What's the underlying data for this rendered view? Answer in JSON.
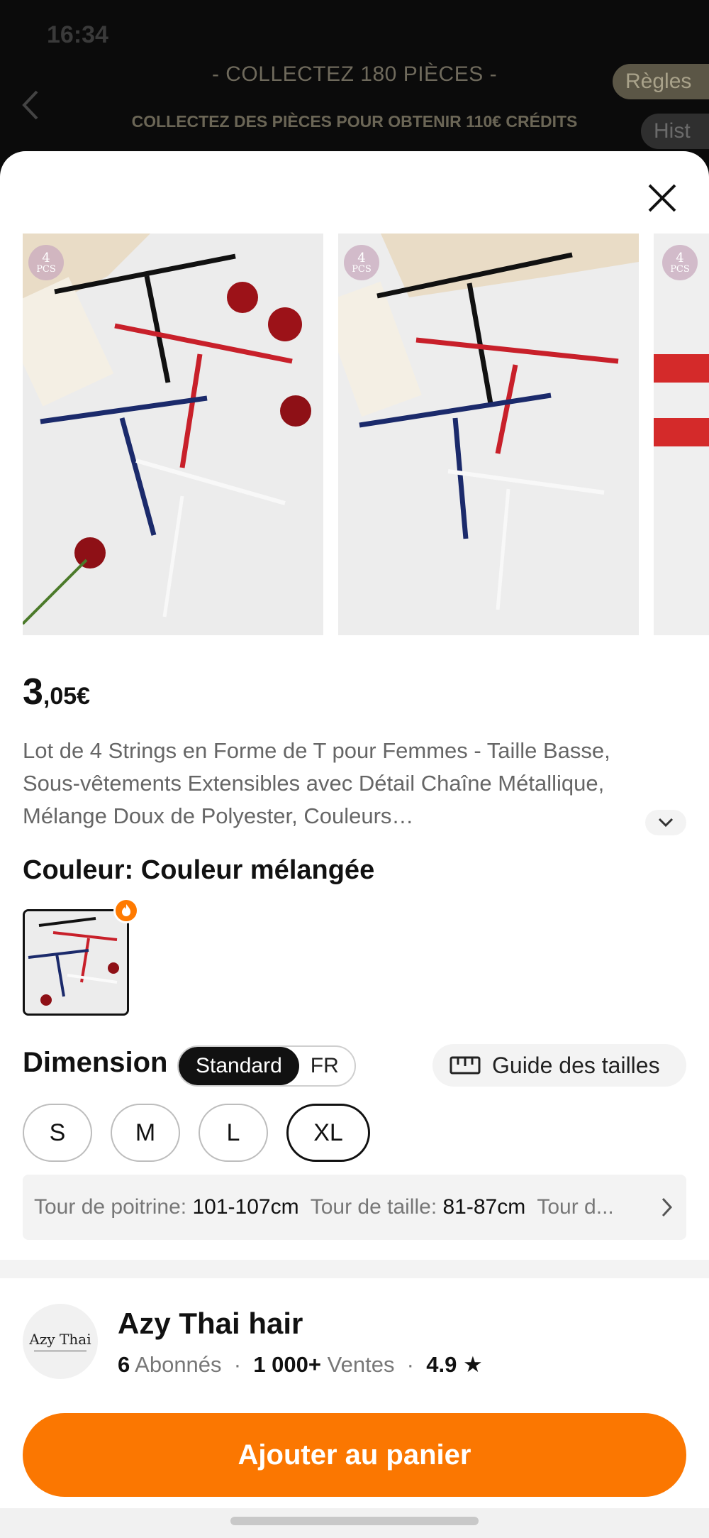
{
  "status_bar": {
    "time": "16:34"
  },
  "background": {
    "title": "- COLLECTEZ 180 PIÈCES -",
    "subtitle": "COLLECTEZ DES PIÈCES POUR OBTENIR 110€ CRÉDITS",
    "rules_button": "Règles",
    "history_button": "Hist"
  },
  "gallery": {
    "badge_number": "4",
    "badge_unit": "PCS",
    "image_count_visible": 3
  },
  "product": {
    "price_whole": "3",
    "price_decimal": ",05€",
    "description": "Lot de 4 Strings en Forme de T pour Femmes - Taille Basse, Sous-vêtements Extensibles avec Détail Chaîne Métallique, Mélange Doux de Polyester, Couleurs…"
  },
  "color": {
    "label": "Couleur:",
    "value": "Couleur mélangée"
  },
  "dimension": {
    "label": "Dimension",
    "unit_options": [
      "Standard",
      "FR"
    ],
    "unit_selected": "Standard",
    "guide_label": "Guide des tailles",
    "sizes": [
      "S",
      "M",
      "L",
      "XL"
    ],
    "selected_size": "XL"
  },
  "measurements": {
    "bust_label": "Tour de poitrine:",
    "bust_value": "101-107cm",
    "waist_label": "Tour de taille:",
    "waist_value": "81-87cm",
    "more_label": "Tour d..."
  },
  "store": {
    "logo_text": "Azy Thai",
    "name": "Azy Thai hair",
    "followers_count": "6",
    "followers_label": "Abonnés",
    "sales_count": "1 000+",
    "sales_label": "Ventes",
    "rating": "4.9"
  },
  "cta": {
    "add_to_cart": "Ajouter au panier"
  },
  "colors": {
    "accent": "#fb7701",
    "selected": "#111111"
  }
}
